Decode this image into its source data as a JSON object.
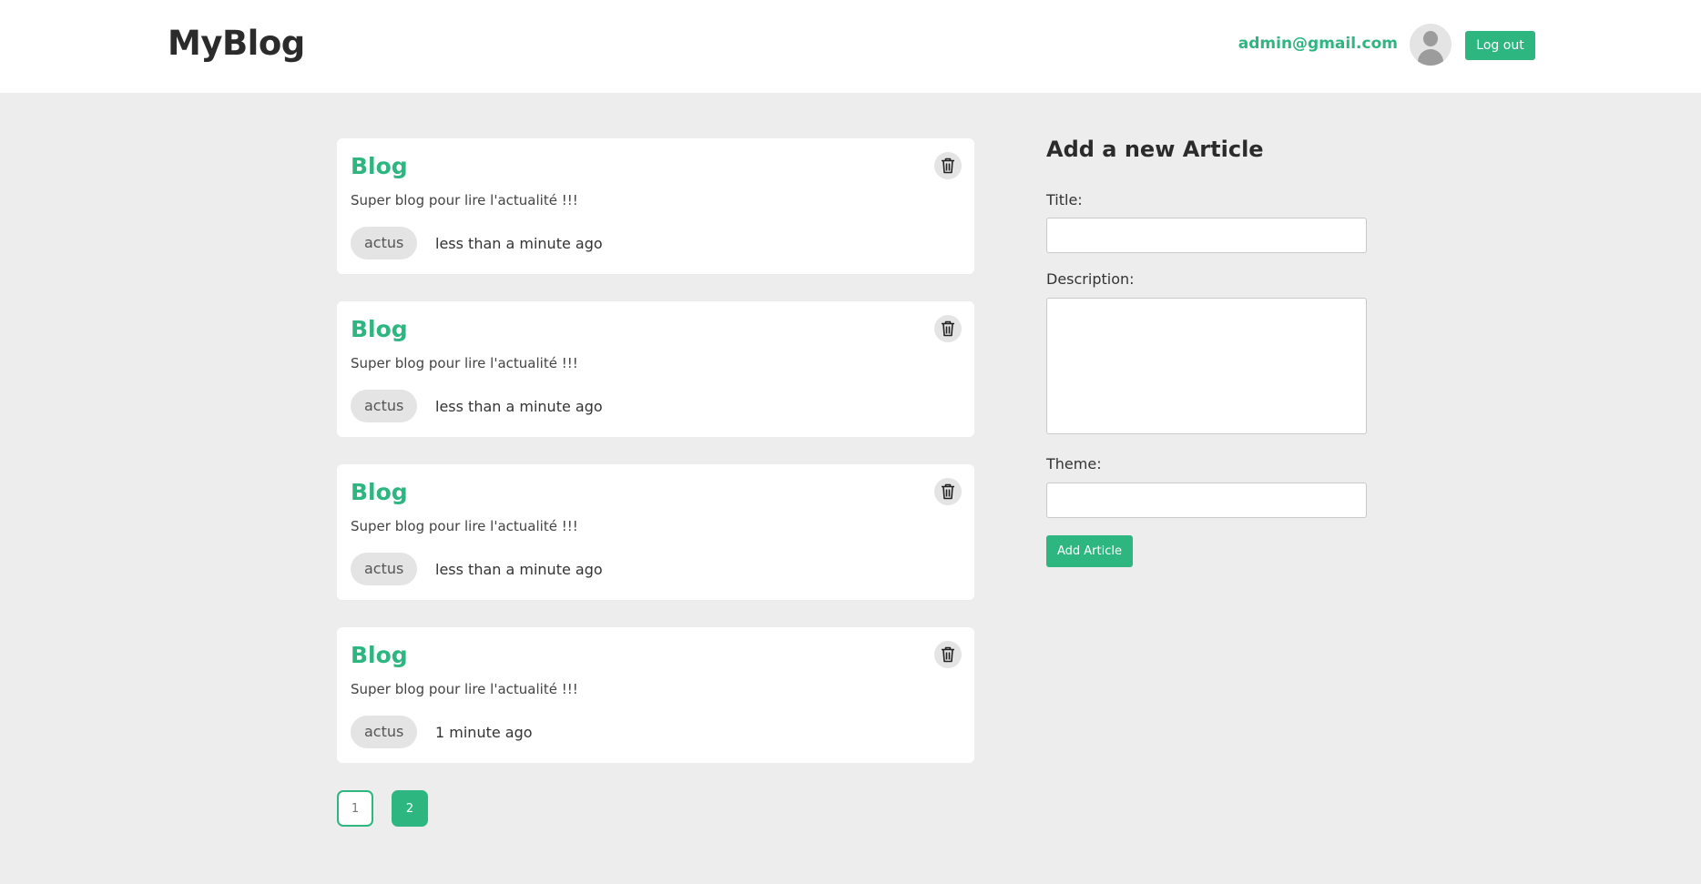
{
  "header": {
    "logo": "MyBlog",
    "user_email": "admin@gmail.com",
    "logout_label": "Log out"
  },
  "articles": [
    {
      "title": "Blog",
      "description": "Super blog pour lire l'actualité !!!",
      "tag": "actus",
      "time": "less than a minute ago"
    },
    {
      "title": "Blog",
      "description": "Super blog pour lire l'actualité !!!",
      "tag": "actus",
      "time": "less than a minute ago"
    },
    {
      "title": "Blog",
      "description": "Super blog pour lire l'actualité !!!",
      "tag": "actus",
      "time": "less than a minute ago"
    },
    {
      "title": "Blog",
      "description": "Super blog pour lire l'actualité !!!",
      "tag": "actus",
      "time": "1 minute ago"
    }
  ],
  "pagination": {
    "pages": [
      "1",
      "2"
    ],
    "current": "2"
  },
  "form": {
    "heading": "Add a new Article",
    "title_label": "Title:",
    "title_value": "",
    "description_label": "Description:",
    "description_value": "",
    "theme_label": "Theme:",
    "theme_value": "",
    "submit_label": "Add Article"
  },
  "icons": {
    "delete": "trash-icon",
    "avatar": "user-avatar-icon"
  },
  "colors": {
    "accent": "#2db680",
    "background": "#ededed",
    "card": "#ffffff",
    "tag_bg": "#e4e4e4"
  }
}
